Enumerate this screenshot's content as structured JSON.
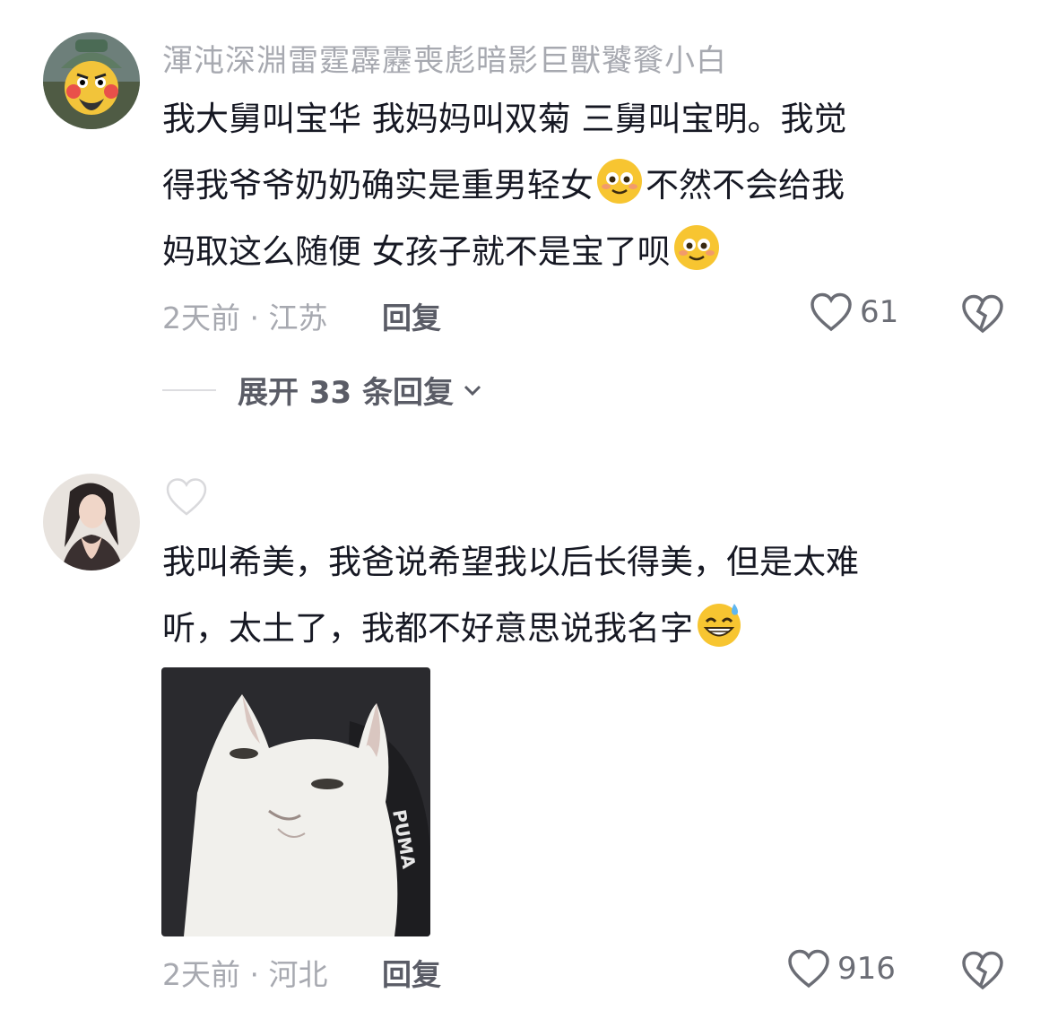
{
  "comments": [
    {
      "username": "渾沌深淵雷霆霹靂喪彪暗影巨獸饕餮小白",
      "text_line1": "我大舅叫宝华 我妈妈叫双菊 三舅叫宝明。我觉",
      "text_line2a": "得我爷爷奶奶确实是重男轻女",
      "text_line2b": "不然不会给我",
      "text_line3": "妈取这么随便 女孩子就不是宝了呗",
      "emoji_1": "smiling-blush-icon",
      "emoji_2": "smiling-blush-icon",
      "time": "2天前",
      "separator": "·",
      "location": "江苏",
      "reply_label": "回复",
      "like_count": "61",
      "expand_label": "展开 33 条回复"
    },
    {
      "username": "",
      "text_line1": "我叫希美，我爸说希望我以后长得美，但是太难",
      "text_line2": "听，太土了，我都不好意思说我名字",
      "emoji": "grinning-sweat-icon",
      "image": "white-cat-meme",
      "time": "2天前",
      "separator": "·",
      "location": "河北",
      "reply_label": "回复",
      "like_count": "916"
    }
  ],
  "colors": {
    "text_primary": "#161823",
    "text_secondary": "#a7a9b0",
    "text_action": "#5a5c66",
    "emoji_yellow": "#f7c531"
  }
}
